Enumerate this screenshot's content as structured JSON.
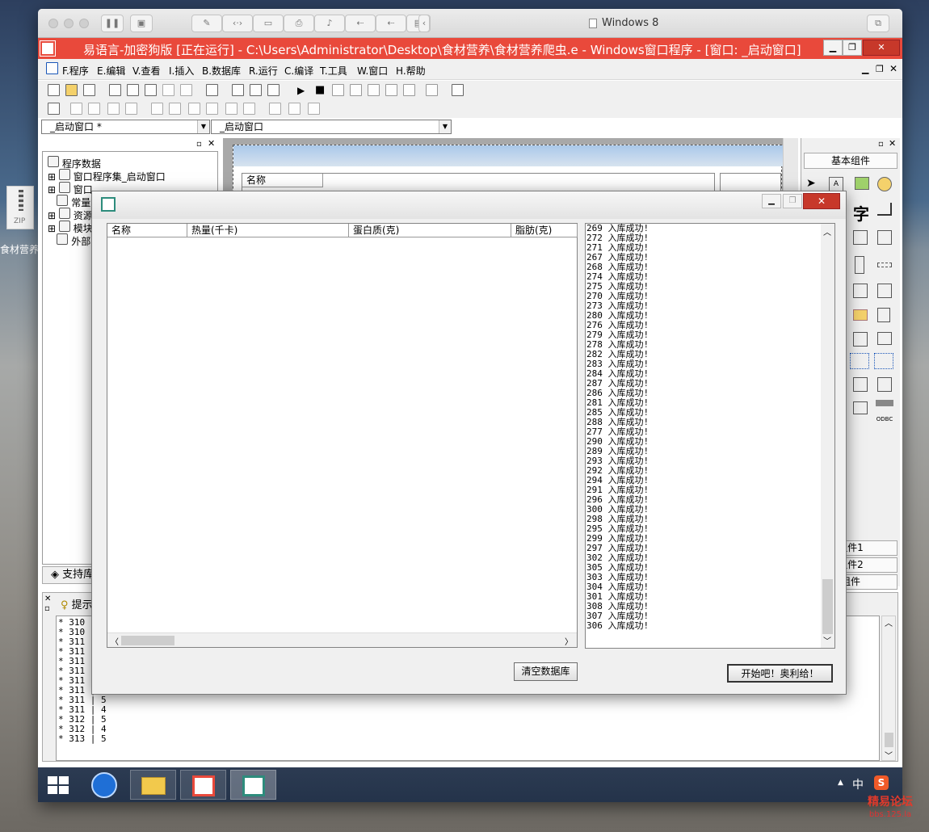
{
  "desktop": {
    "zip_label": "ZIP",
    "file_label": "食材营养."
  },
  "mac": {
    "title": "Windows 8"
  },
  "ide": {
    "title": "易语言-加密狗版 [正在运行] - C:\\Users\\Administrator\\Desktop\\食材营养\\食材营养爬虫.e - Windows窗口程序 - [窗口: _启动窗口]",
    "menus": [
      "F.程序",
      "E.编辑",
      "V.查看",
      "I.插入",
      "B.数据库",
      "R.运行",
      "C.编译",
      "T.工具",
      "W.窗口",
      "H.帮助"
    ],
    "combo_left": "_启动窗口 *",
    "combo_right": "_启动窗口",
    "tree": [
      "程序数据",
      "窗口程序集_启动窗口",
      "窗口",
      "常量",
      "资源",
      "模块",
      "外部"
    ],
    "designer_col": "名称",
    "support_tab": "支持库",
    "hint_tab": "提示",
    "right_title": "基本组件",
    "right_char": "字",
    "group_tabs": [
      "组件1",
      "组件2",
      "组件"
    ],
    "output_lines": [
      "* 310 |",
      "* 310 |",
      "* 311 |",
      "* 311 |",
      "* 311 |",
      "* 311 |",
      "* 311 |",
      "* 311 |",
      "* 311 | 5",
      "* 311 | 4",
      "* 312 | 5",
      "* 312 | 4",
      "* 313 | 5"
    ]
  },
  "dialog": {
    "columns": [
      "名称",
      "热量(千卡)",
      "蛋白质(克)",
      "脂肪(克)"
    ],
    "log_lines": [
      "269 入库成功!",
      "272 入库成功!",
      "271 入库成功!",
      "267 入库成功!",
      "268 入库成功!",
      "274 入库成功!",
      "275 入库成功!",
      "270 入库成功!",
      "273 入库成功!",
      "280 入库成功!",
      "276 入库成功!",
      "279 入库成功!",
      "278 入库成功!",
      "282 入库成功!",
      "283 入库成功!",
      "284 入库成功!",
      "287 入库成功!",
      "286 入库成功!",
      "281 入库成功!",
      "285 入库成功!",
      "288 入库成功!",
      "277 入库成功!",
      "290 入库成功!",
      "289 入库成功!",
      "293 入库成功!",
      "292 入库成功!",
      "294 入库成功!",
      "291 入库成功!",
      "296 入库成功!",
      "300 入库成功!",
      "298 入库成功!",
      "295 入库成功!",
      "299 入库成功!",
      "297 入库成功!",
      "302 入库成功!",
      "305 入库成功!",
      "303 入库成功!",
      "304 入库成功!",
      "301 入库成功!",
      "308 入库成功!",
      "307 入库成功!",
      "306 入库成功!"
    ],
    "clear_button": "清空数据库",
    "start_button": "开始吧！奥利给！"
  },
  "taskbar": {
    "ime": "中"
  },
  "watermark": {
    "line1": "精易论坛",
    "line2": "bbs.125.la"
  }
}
